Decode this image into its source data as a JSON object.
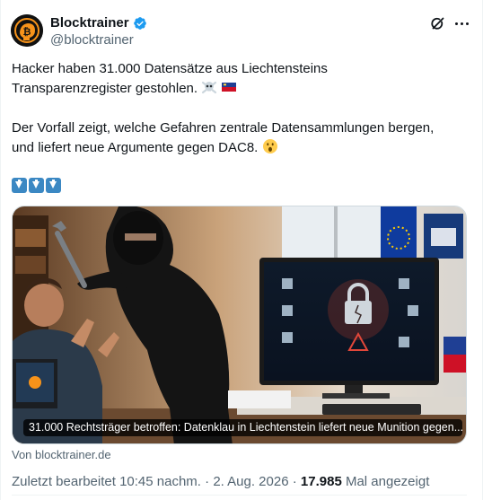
{
  "author": {
    "display_name": "Blocktrainer",
    "handle": "@blocktrainer",
    "verified": true,
    "avatar_icon": "bitcoin-brain-logo",
    "verified_color": "#1d9bf0"
  },
  "tweet": {
    "line1": "Hacker haben 31.000 Datensätze aus Liechtensteins",
    "line2": "Transparenzregister gestohlen.",
    "line3": "Der Vorfall zeigt, welche Gefahren zentrale Datensammlungen bergen,",
    "line4": "und liefert neue Argumente gegen DAC8.",
    "emojis": [
      "skull-crossbones-icon",
      "liechtenstein-flag-icon",
      "astonished-face-icon",
      "down-arrow-icon",
      "down-arrow-icon",
      "down-arrow-icon"
    ]
  },
  "media": {
    "caption": "31.000 Rechtsträger betroffen: Datenklau in Liechtenstein liefert neue Munition gegen...",
    "source": "Von blocktrainer.de"
  },
  "meta": {
    "edited": "Zuletzt bearbeitet 10:45 nachm.",
    "separator1": " · ",
    "date": "2. Aug. 2026",
    "separator2": " · ",
    "views": "17.985",
    "views_label": " Mal angezeigt"
  },
  "colors": {
    "text": "#0f1419",
    "secondary": "#536471",
    "accent": "#1d9bf0",
    "arrow_blue": "#3b88c3"
  }
}
